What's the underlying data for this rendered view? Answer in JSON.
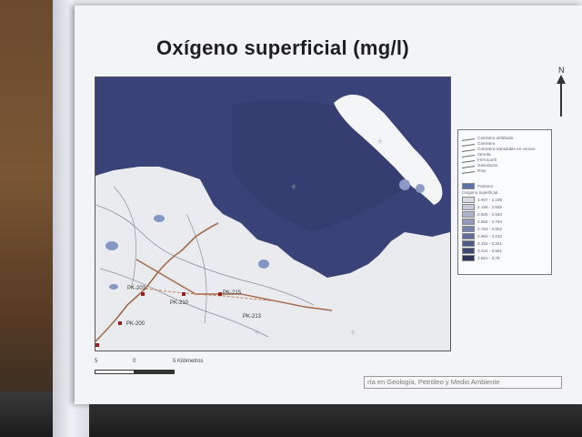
{
  "title": "Oxígeno superficial (mg/l)",
  "north_label": "N",
  "map": {
    "stations": [
      "PK-203",
      "PK-210",
      "PK-215",
      "PK-213",
      "PK-200"
    ]
  },
  "legend": {
    "line_items": [
      "Carretera asfaltada",
      "Carretera",
      "Carretera transitable en verano",
      "Vereda",
      "Ferrocarril",
      "Gasoducto",
      "Ríos"
    ],
    "fill_items": [
      "Pantano"
    ],
    "ramp_title": "Oxígeno superficial",
    "ramp_classes": [
      "1.997 - 2.186",
      "2.186 - 2.565",
      "2.565 - 2.584",
      "2.584 - 2.763",
      "2.763 - 2.952",
      "2.952 - 3.152",
      "3.152 - 3.341",
      "3.341 - 3.561",
      "3.561 - 3.78"
    ],
    "ramp_colors": [
      "#d9dbe6",
      "#c3c8da",
      "#aab2cd",
      "#9199bd",
      "#7a83ad",
      "#646d9b",
      "#505987",
      "#3e4672",
      "#2d3459"
    ]
  },
  "scale": {
    "labels": [
      "5",
      "0",
      "5 Kilómetros"
    ]
  },
  "footer": {
    "text": "ría en Geología, Petróleo y Medio Ambiente"
  },
  "colors": {
    "water": "#3a4378",
    "land": "#e9ebee",
    "island": "#f4f5f7",
    "station": "#9a2020"
  }
}
